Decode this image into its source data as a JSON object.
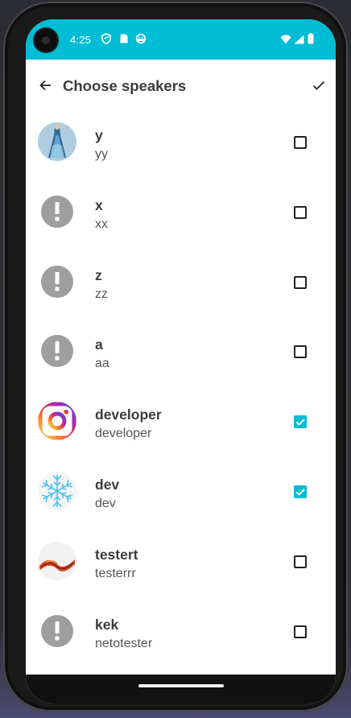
{
  "status_bar": {
    "time": "4:25",
    "icons_left": [
      "shield-icon",
      "sim-card-icon",
      "android-head-icon"
    ],
    "icons_right": [
      "wifi-icon",
      "signal-icon",
      "battery-icon"
    ],
    "color": "#00bcd4"
  },
  "app_bar": {
    "title": "Choose speakers",
    "back_icon": "arrow-back-icon",
    "confirm_icon": "checkmark-icon"
  },
  "accent_color": "#00bcd4",
  "speakers": [
    {
      "name": "y",
      "username": "yy",
      "avatar": "photo-blue-dress",
      "checked": false
    },
    {
      "name": "x",
      "username": "xx",
      "avatar": "warning",
      "checked": false
    },
    {
      "name": "z",
      "username": "zz",
      "avatar": "warning",
      "checked": false
    },
    {
      "name": "a",
      "username": "aa",
      "avatar": "warning",
      "checked": false
    },
    {
      "name": "developer",
      "username": "developer",
      "avatar": "instagram-logo",
      "checked": true
    },
    {
      "name": "dev",
      "username": "dev",
      "avatar": "snowflake",
      "checked": true
    },
    {
      "name": "testert",
      "username": "testerrr",
      "avatar": "ribbon",
      "checked": false
    },
    {
      "name": "kek",
      "username": "netotester",
      "avatar": "warning",
      "checked": false
    }
  ]
}
